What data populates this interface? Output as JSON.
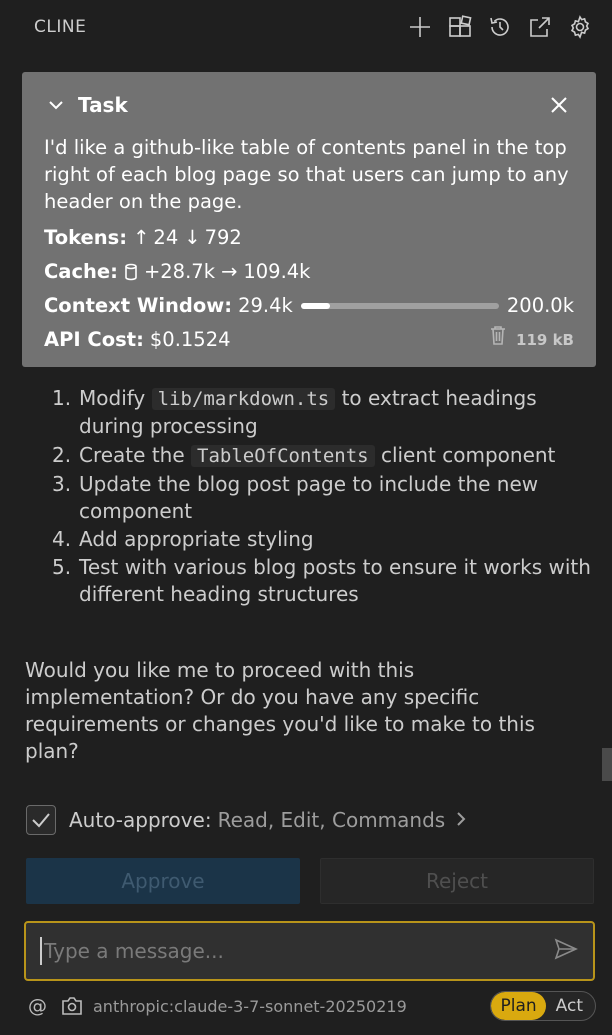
{
  "header": {
    "title": "CLINE",
    "icons": [
      "plus-icon",
      "mcp-servers-icon",
      "history-icon",
      "popout-icon",
      "settings-icon"
    ]
  },
  "task": {
    "title": "Task",
    "text": "I'd like a github-like table of contents panel in the top right of each blog page so that users can jump to any header on the page.",
    "tokens_label": "Tokens:",
    "tokens_in": "24",
    "tokens_out": "792",
    "cache_label": "Cache:",
    "cache_write": "+28.7k",
    "cache_read": "109.4k",
    "context_label": "Context Window:",
    "context_used": "29.4k",
    "context_max": "200.0k",
    "context_fraction": 0.147,
    "api_cost_label": "API Cost:",
    "api_cost": "$0.1524",
    "size": "119 kB"
  },
  "steps": [
    {
      "num": "1.",
      "pre": "Modify ",
      "code": "lib/markdown.ts",
      "post": " to extract headings during processing"
    },
    {
      "num": "2.",
      "pre": "Create the ",
      "code": "TableOfContents",
      "post": " client component"
    },
    {
      "num": "3.",
      "pre": "Update the blog post page to include the new component",
      "code": "",
      "post": ""
    },
    {
      "num": "4.",
      "pre": "Add appropriate styling",
      "code": "",
      "post": ""
    },
    {
      "num": "5.",
      "pre": "Test with various blog posts to ensure it works with different heading structures",
      "code": "",
      "post": ""
    }
  ],
  "paragraph": "Would you like me to proceed with this implementation? Or do you have any specific requirements or changes you'd like to make to this plan?",
  "auto_approve": {
    "checked": true,
    "label": "Auto-approve:",
    "value": "Read, Edit, Commands"
  },
  "buttons": {
    "approve": "Approve",
    "reject": "Reject"
  },
  "input": {
    "placeholder": "Type a message...",
    "value": ""
  },
  "footer": {
    "at": "@",
    "model": "anthropic:claude-3-7-sonnet-20250219",
    "mode_plan": "Plan",
    "mode_act": "Act",
    "active_mode": "Plan"
  },
  "colors": {
    "accent": "#d9a90f",
    "task_bg": "#727272",
    "approve_bg": "#1b3448"
  }
}
